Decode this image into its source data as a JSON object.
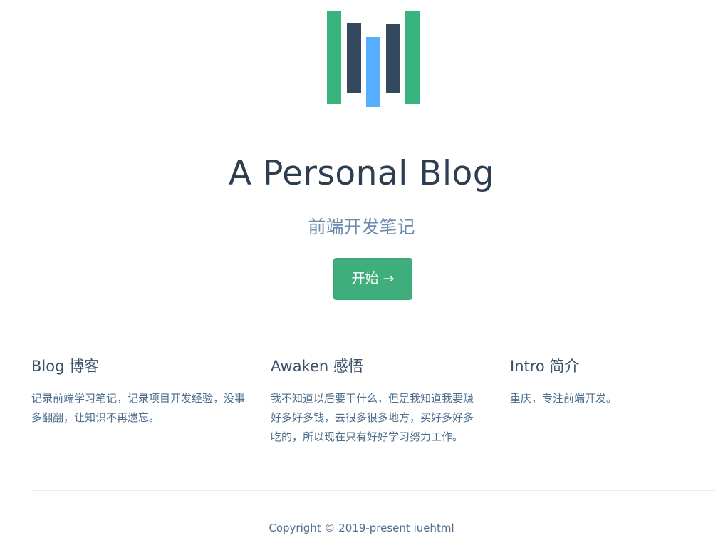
{
  "hero": {
    "title": "A Personal Blog",
    "description": "前端开发笔记",
    "action_label": "开始 →"
  },
  "features": [
    {
      "title": "Blog 博客",
      "details": "记录前端学习笔记，记录项目开发经验，没事多翻翻，让知识不再遗忘。"
    },
    {
      "title": "Awaken 感悟",
      "details": "我不知道以后要干什么，但是我知道我要赚好多好多钱，去很多很多地方，买好多好多吃的，所以现在只有好好学习努力工作。"
    },
    {
      "title": "Intro 简介",
      "details": "重庆，专注前端开发。"
    }
  ],
  "footer": {
    "text": "Copyright © 2019-present iuehtml"
  },
  "colors": {
    "accent": "#3eaf7c",
    "logo_green": "#38b57e",
    "logo_dark": "#34495e",
    "logo_blue": "#57aefe"
  }
}
